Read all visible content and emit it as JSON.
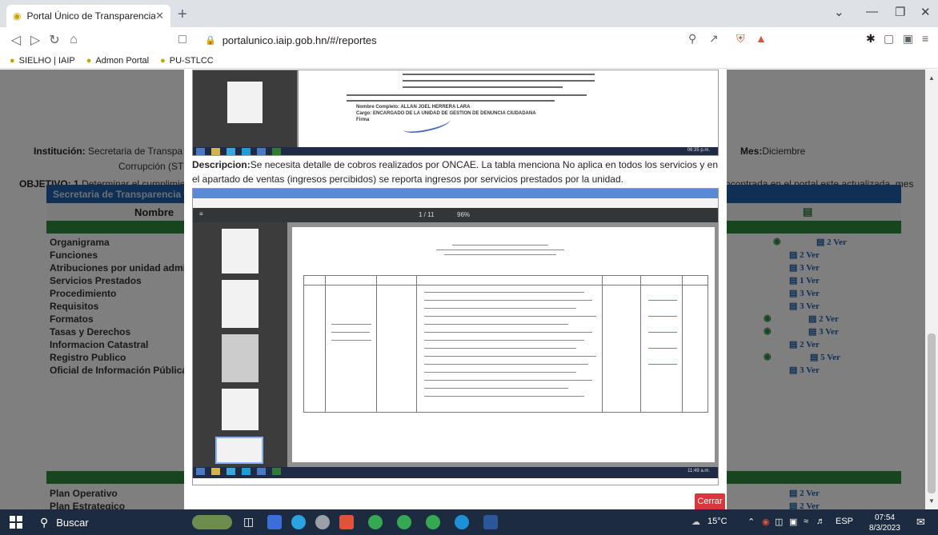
{
  "browser": {
    "tab_title": "Portal Único de Transparencia",
    "url": "portalunico.iaip.gob.hn/#/reportes",
    "bookmarks": [
      "SIELHO | IAIP",
      "Admon Portal",
      "PU-STLCC"
    ]
  },
  "page": {
    "institucion_label": "Institución:",
    "institucion_value": "Secretaria de Transpa",
    "institucion_value2": "Corrupción (STL",
    "mes_label": "Mes:",
    "mes_value": "Diciembre",
    "objetivo_label": "OBJETIVO:",
    "objetivo_num": "1",
    "objetivo_text": "Determinar el cumplimien",
    "objetivo_text_right": "ncontrada en el portal este actualizada, mes",
    "table_header": "Secretaria de Transparencia y L",
    "column_nombre": "Nombre",
    "rows": [
      {
        "name": "Organigrama",
        "eye": true,
        "ver": "2 Ver"
      },
      {
        "name": "Funciones",
        "eye": false,
        "ver": "2 Ver"
      },
      {
        "name": "Atribuciones por unidad admini",
        "eye": false,
        "ver": "3 Ver"
      },
      {
        "name": "Servicios Prestados",
        "eye": false,
        "ver": "1 Ver"
      },
      {
        "name": "Procedimiento",
        "eye": false,
        "ver": "3 Ver"
      },
      {
        "name": "Requisitos",
        "eye": false,
        "ver": "3 Ver"
      },
      {
        "name": "Formatos",
        "eye": true,
        "ver": "2 Ver"
      },
      {
        "name": "Tasas y Derechos",
        "eye": true,
        "ver": "3 Ver"
      },
      {
        "name": "Informacion Catastral",
        "eye": false,
        "ver": "2 Ver"
      },
      {
        "name": "Registro Publico",
        "eye": true,
        "ver": "5 Ver"
      },
      {
        "name": "Oficial de Información Pública (",
        "eye": false,
        "ver": "3 Ver"
      }
    ],
    "rows2": [
      {
        "name": "Plan Operativo",
        "ver": "2 Ver"
      },
      {
        "name": "Plan Estrategico",
        "ver": "2 Ver"
      }
    ]
  },
  "modal": {
    "desc_label": "Descripcion:",
    "desc_text": "Se necesita detalle de cobros realizados por ONCAE. La tabla menciona No aplica en todos los servicios y en el apartado de ventas (ingresos percibidos) se reporta ingresos por servicios prestados por la unidad.",
    "ss_top_nombre": "Nombre Completo: ALLAN JOEL HERRERA LARA",
    "ss_top_cargo": "Cargo: ENCARGADO DE LA UNIDAD DE GESTION DE DENUNCIA CIUDADANA",
    "ss_top_firma": "Firma",
    "ss_top_clock": "06:35 p.m.",
    "ss_bottom_clock": "11:49 a.m.",
    "pdf_page": "1 / 11",
    "pdf_zoom": "96%",
    "close_label": "Cerrar"
  },
  "taskbar": {
    "search_label": "Buscar",
    "temperature": "15°C",
    "language": "ESP",
    "time": "07:54",
    "date": "8/3/2023"
  }
}
